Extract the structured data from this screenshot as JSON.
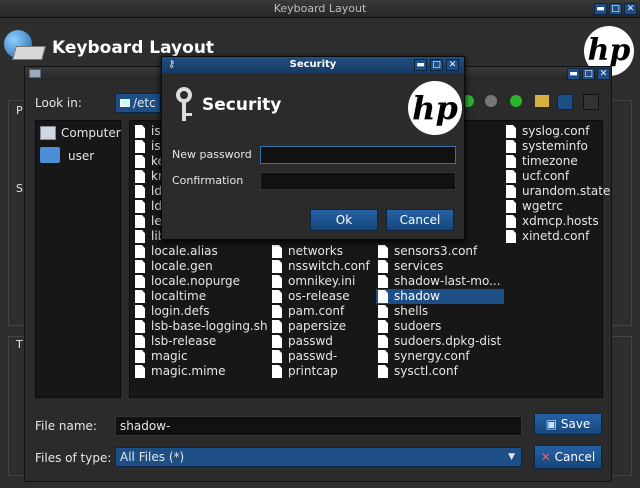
{
  "outer": {
    "title": "Keyboard Layout",
    "header_title": "Keyboard Layout",
    "logo": "hp",
    "left_letters": [
      "P",
      "S",
      "T"
    ]
  },
  "file_dialog": {
    "look_in_label": "Look in:",
    "look_in_value": "/etc",
    "places": [
      {
        "label": "Computer",
        "icon": "computer-icon"
      },
      {
        "label": "user",
        "icon": "folder-icon"
      }
    ],
    "col1_partial": [
      "is",
      "is",
      "ke",
      "kr",
      "ld",
      "ld",
      "le",
      "lib"
    ],
    "col1": [
      "locale.alias",
      "locale.gen",
      "locale.nopurge",
      "localtime",
      "login.defs",
      "lsb-base-logging.sh",
      "lsb-release",
      "magic",
      "magic.mime"
    ],
    "col2": [
      "networks",
      "nsswitch.conf",
      "omnikey.ini",
      "os-release",
      "pam.conf",
      "papersize",
      "passwd",
      "passwd-",
      "printcap"
    ],
    "col3": [
      "sensors3.conf",
      "services",
      "shadow-last-mo...",
      "shadow",
      "shells",
      "sudoers",
      "sudoers.dpkg-dist",
      "synergy.conf",
      "sysctl.conf"
    ],
    "col4": [
      "syslog.conf",
      "systeminfo",
      "timezone",
      "ucf.conf",
      "urandom.state",
      "wgetrc",
      "xdmcp.hosts",
      "xinetd.conf"
    ],
    "selected": "shadow",
    "file_name_label": "File name:",
    "file_name_value": "shadow-",
    "file_type_label": "Files of type:",
    "file_type_value": "All Files (*)",
    "save_label": "Save",
    "cancel_label": "Cancel"
  },
  "security": {
    "window_title": "Security",
    "heading": "Security",
    "logo": "hp",
    "new_password_label": "New password",
    "confirmation_label": "Confirmation",
    "new_password_value": "",
    "confirmation_value": "",
    "ok_label": "Ok",
    "cancel_label": "Cancel"
  }
}
